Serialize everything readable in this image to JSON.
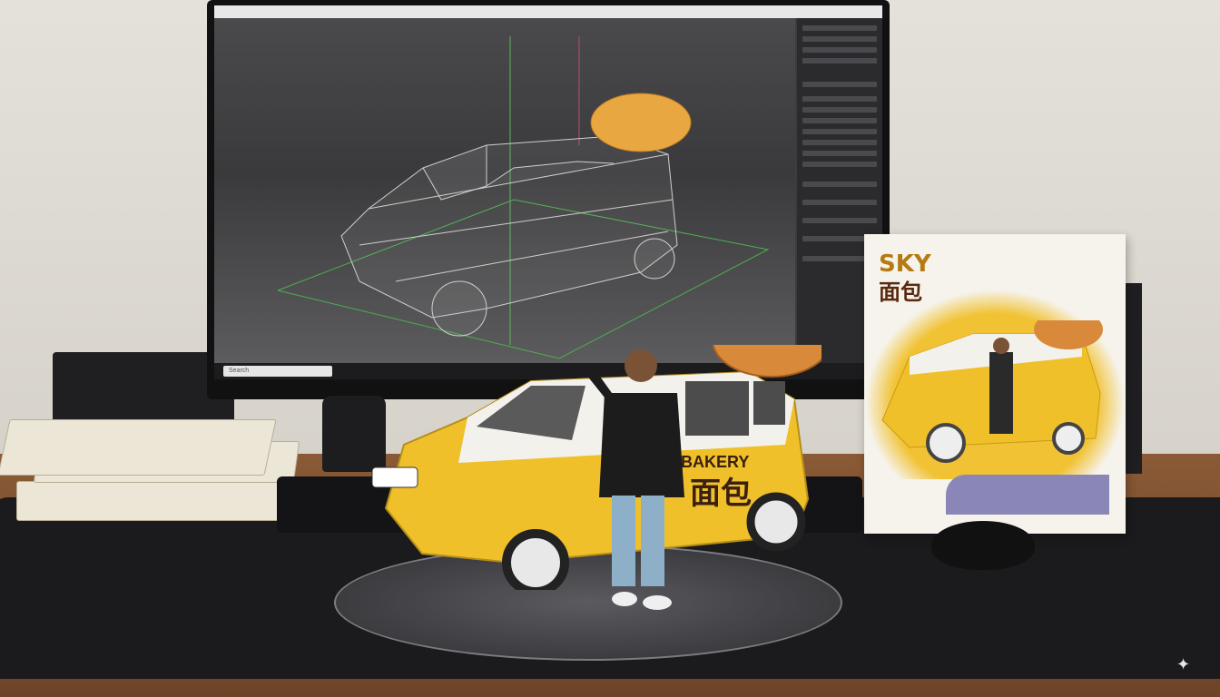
{
  "screen": {
    "taskbar_search": "Search",
    "title_bar": ""
  },
  "box": {
    "brand_text": "SKY",
    "brand_cn": "面包",
    "bottom_label": ""
  },
  "car": {
    "side_text_en": "BAKERY",
    "side_text_cn": "面包"
  },
  "colors": {
    "car_yellow": "#f0c02a",
    "car_white": "#f3f1ec",
    "bread": "#d9893a",
    "mat": "#1b1b1d",
    "desk": "#7a4c2e"
  },
  "icons": {
    "corner": "sparkle-icon"
  }
}
